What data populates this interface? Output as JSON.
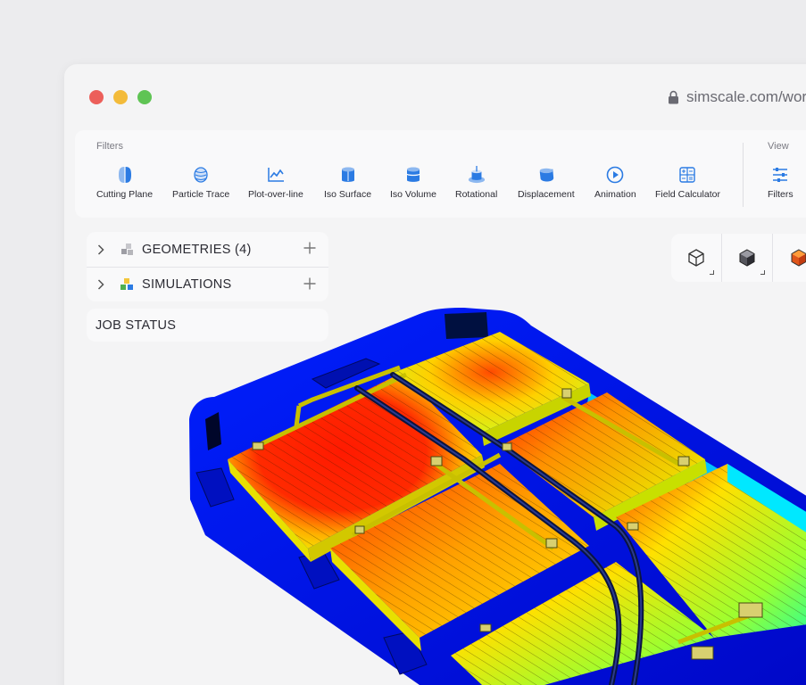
{
  "browser": {
    "url": "simscale.com/worl",
    "controls": [
      "close",
      "minimize",
      "maximize"
    ]
  },
  "toolbar": {
    "filters_label": "Filters",
    "view_label": "View",
    "tools": [
      {
        "label": "Cutting Plane",
        "icon": "cutting-plane-icon"
      },
      {
        "label": "Particle Trace",
        "icon": "particle-trace-icon"
      },
      {
        "label": "Plot-over-line",
        "icon": "plot-over-line-icon"
      },
      {
        "label": "Iso Surface",
        "icon": "iso-surface-icon"
      },
      {
        "label": "Iso Volume",
        "icon": "iso-volume-icon"
      },
      {
        "label": "Rotational",
        "icon": "rotational-icon"
      },
      {
        "label": "Displacement",
        "icon": "displacement-icon"
      },
      {
        "label": "Animation",
        "icon": "animation-icon"
      },
      {
        "label": "Field Calculator",
        "icon": "field-calculator-icon"
      }
    ],
    "view_tools": [
      {
        "label": "Filters",
        "icon": "sliders-icon"
      }
    ]
  },
  "tree": {
    "geometries": "GEOMETRIES (4)",
    "simulations": "SIMULATIONS"
  },
  "job_status": "JOB STATUS",
  "view_buttons": [
    "wireframe-cube-icon",
    "solid-cube-icon",
    "colored-cube-icon"
  ],
  "colors": {
    "accent": "#2b7be3",
    "contour_hot": "#ff1a00",
    "contour_mid": "#ffe600",
    "contour_cold": "#0018e8",
    "contour_cool": "#00e0ff"
  }
}
